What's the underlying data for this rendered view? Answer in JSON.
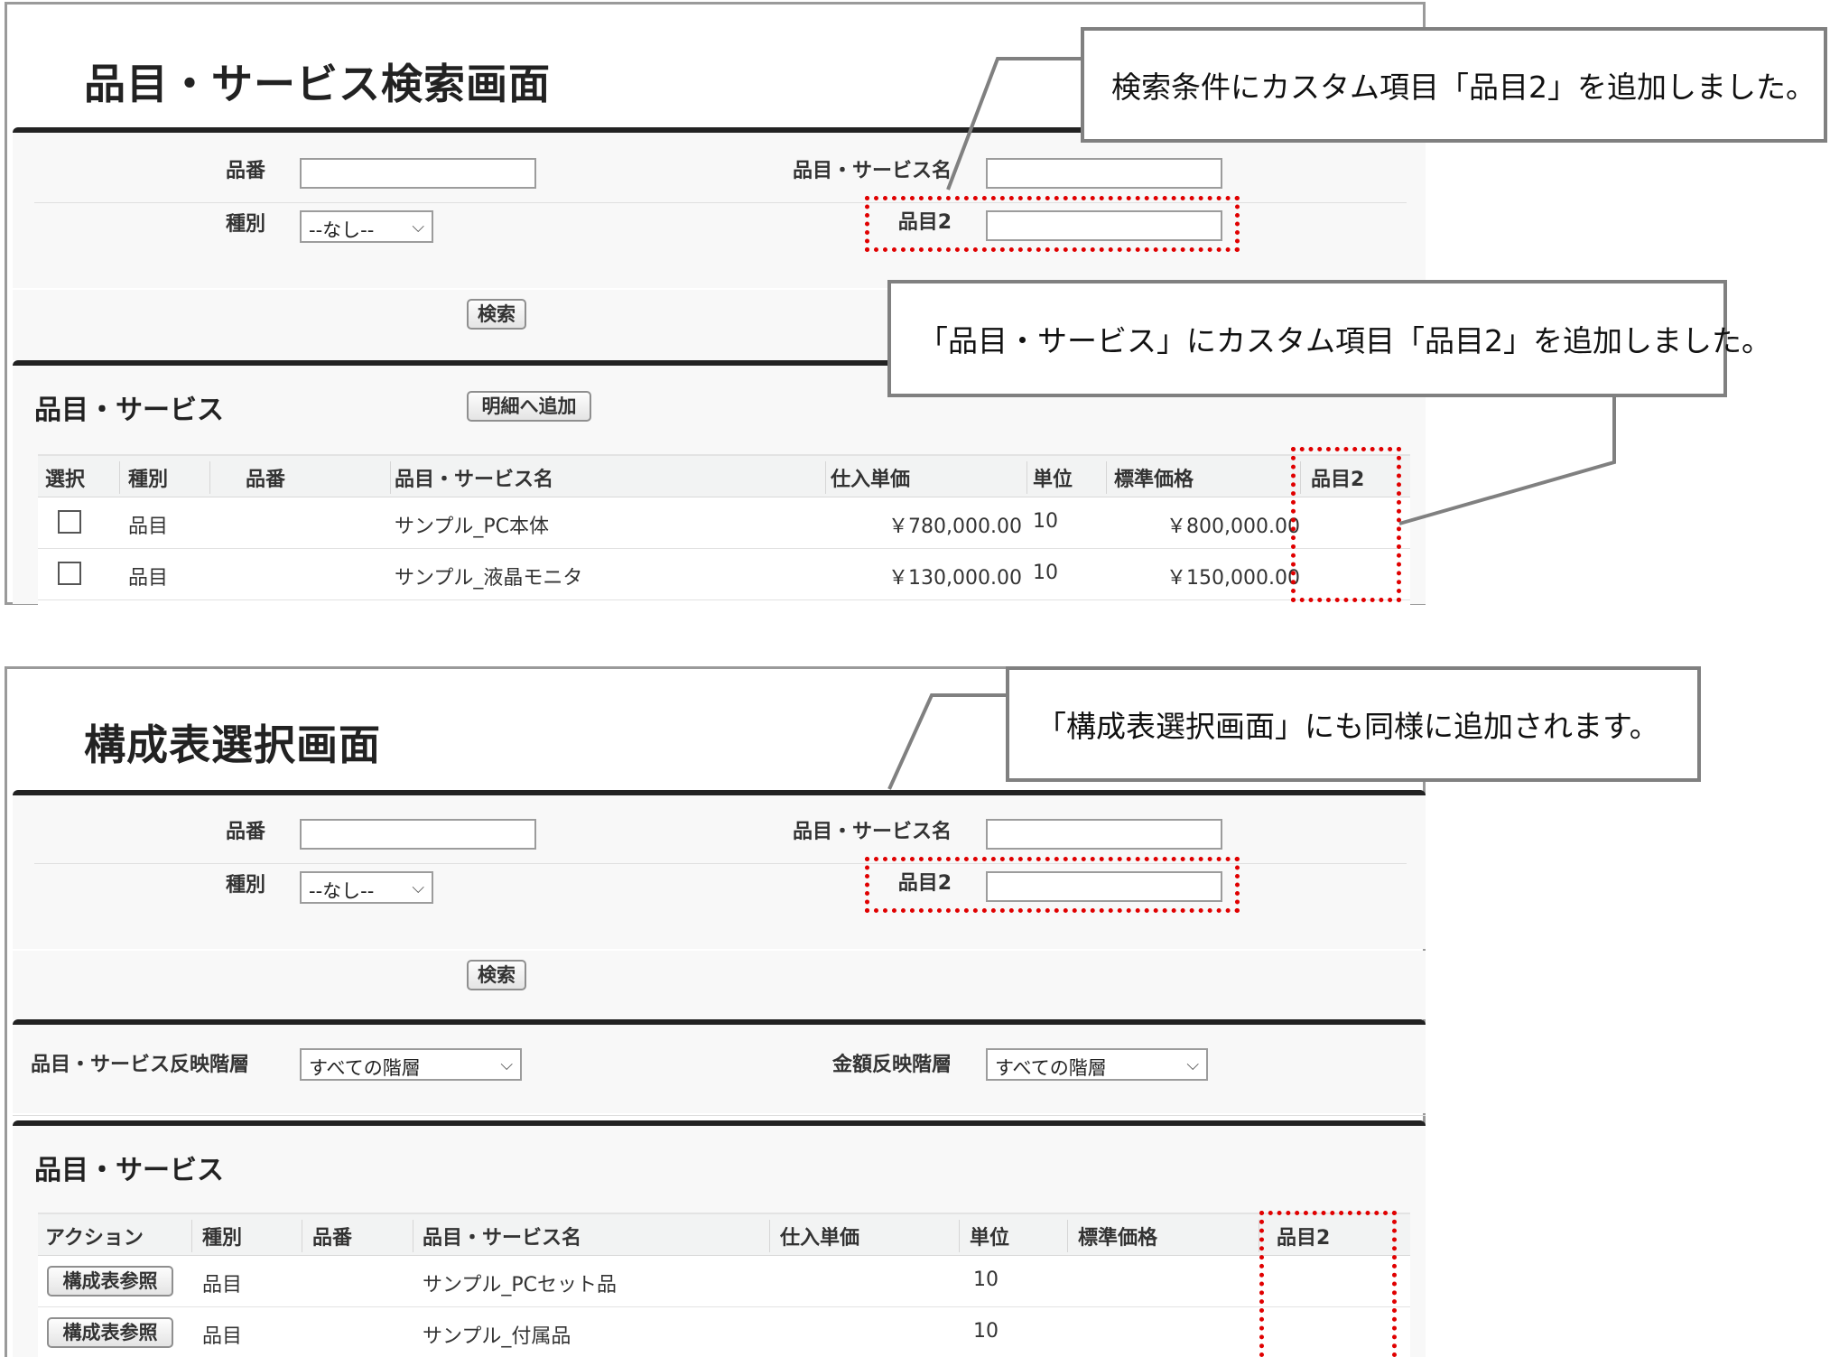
{
  "screen1": {
    "title": "品目・サービス検索画面",
    "search": {
      "part_no_label": "品番",
      "name_label": "品目・サービス名",
      "type_label": "種別",
      "type_value": "--なし--",
      "item2_label": "品目2",
      "search_button": "検索"
    },
    "list": {
      "section_title": "品目・サービス",
      "add_button": "明細へ追加",
      "columns": [
        "選択",
        "種別",
        "品番",
        "品目・サービス名",
        "仕入単価",
        "単位",
        "標準価格",
        "品目2"
      ],
      "rows": [
        {
          "type": "品目",
          "part_no": "",
          "name": "サンプル_PC本体",
          "cost": "￥780,000.00",
          "unit": "10",
          "price": "￥800,000.00",
          "item2": ""
        },
        {
          "type": "品目",
          "part_no": "",
          "name": "サンプル_液晶モニタ",
          "cost": "￥130,000.00",
          "unit": "10",
          "price": "￥150,000.00",
          "item2": ""
        }
      ]
    }
  },
  "screen2": {
    "title": "構成表選択画面",
    "search": {
      "part_no_label": "品番",
      "name_label": "品目・サービス名",
      "type_label": "種別",
      "type_value": "--なし--",
      "item2_label": "品目2",
      "search_button": "検索"
    },
    "levels": {
      "item_level_label": "品目・サービス反映階層",
      "item_level_value": "すべての階層",
      "amount_level_label": "金額反映階層",
      "amount_level_value": "すべての階層"
    },
    "list": {
      "section_title": "品目・サービス",
      "columns": [
        "アクション",
        "種別",
        "品番",
        "品目・サービス名",
        "仕入単価",
        "単位",
        "標準価格",
        "品目2"
      ],
      "rows": [
        {
          "action": "構成表参照",
          "type": "品目",
          "part_no": "",
          "name": "サンプル_PCセット品",
          "cost": "",
          "unit": "10",
          "price": "",
          "item2": ""
        },
        {
          "action": "構成表参照",
          "type": "品目",
          "part_no": "",
          "name": "サンプル_付属品",
          "cost": "",
          "unit": "10",
          "price": "",
          "item2": ""
        }
      ]
    }
  },
  "callouts": {
    "search_condition": "検索条件にカスタム項目「品目2」を追加しました。",
    "item_service": "「品目・サービス」にカスタム項目「品目2」を追加しました。",
    "composition": "「構成表選択画面」にも同様に追加されます。"
  },
  "colors": {
    "highlight": "#e00000",
    "callout_border": "#808080",
    "block_bar": "#222222"
  },
  "icons": {
    "dropdown": "chevron-down-icon"
  }
}
